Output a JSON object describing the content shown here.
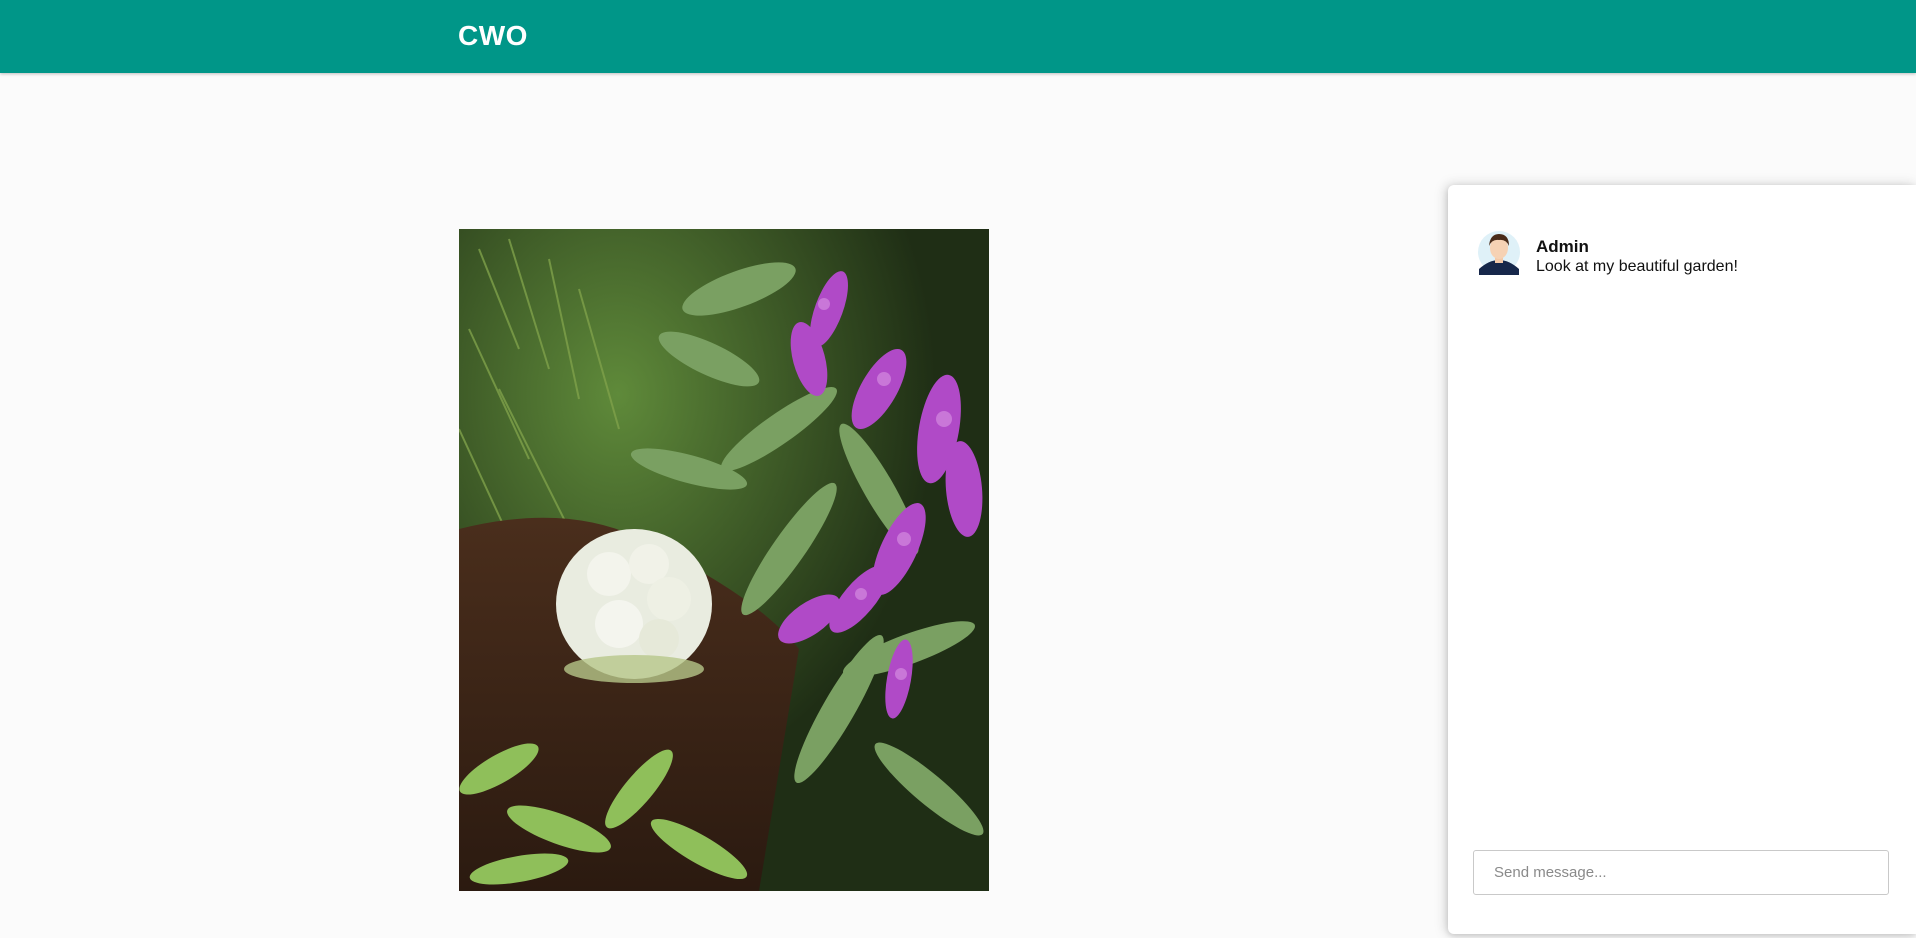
{
  "header": {
    "brand": "CWO",
    "color": "#009688"
  },
  "main": {
    "photo": {
      "subject": "garden-photo"
    }
  },
  "chat": {
    "messages": [
      {
        "author": "Admin",
        "text": "Look at my beautiful garden!",
        "avatar_icon": "user-avatar-icon"
      }
    ],
    "input": {
      "value": "",
      "placeholder": "Send message..."
    }
  }
}
